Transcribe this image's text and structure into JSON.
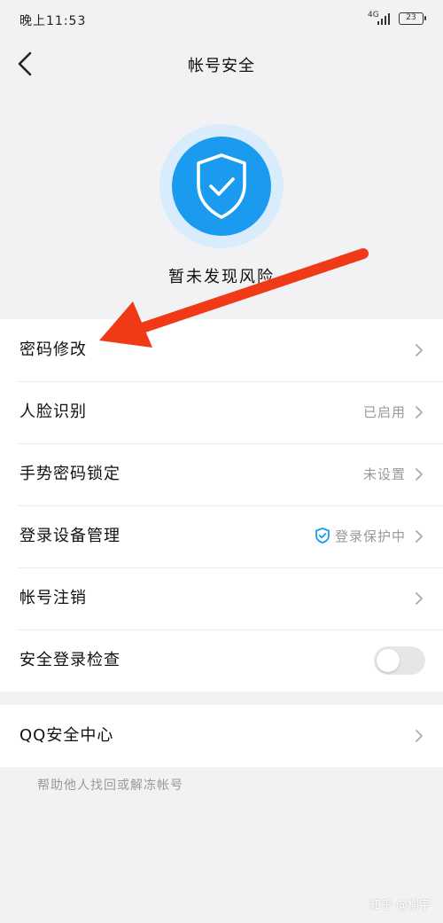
{
  "status_bar": {
    "time": "晚上11:53",
    "network": "4G",
    "battery": "23"
  },
  "nav": {
    "title": "帐号安全",
    "back_icon": "chevron-left-icon"
  },
  "hero": {
    "icon": "shield-check-icon",
    "status_text": "暂未发现风险",
    "color_disc": "#1a9bf0",
    "color_halo": "#d8ecfb"
  },
  "settings": {
    "items": [
      {
        "label": "密码修改",
        "value": ""
      },
      {
        "label": "人脸识别",
        "value": "已启用"
      },
      {
        "label": "手势密码锁定",
        "value": "未设置"
      },
      {
        "label": "登录设备管理",
        "value": "登录保护中",
        "value_icon": "shield-check-icon"
      },
      {
        "label": "帐号注销",
        "value": ""
      },
      {
        "label": "安全登录检查",
        "toggle": false
      }
    ]
  },
  "qq_center": {
    "label": "QQ安全中心",
    "footer": "帮助他人找回或解冻帐号"
  },
  "annotation": {
    "arrow_color": "#f03a17"
  },
  "watermark": "知乎 @桐宇"
}
